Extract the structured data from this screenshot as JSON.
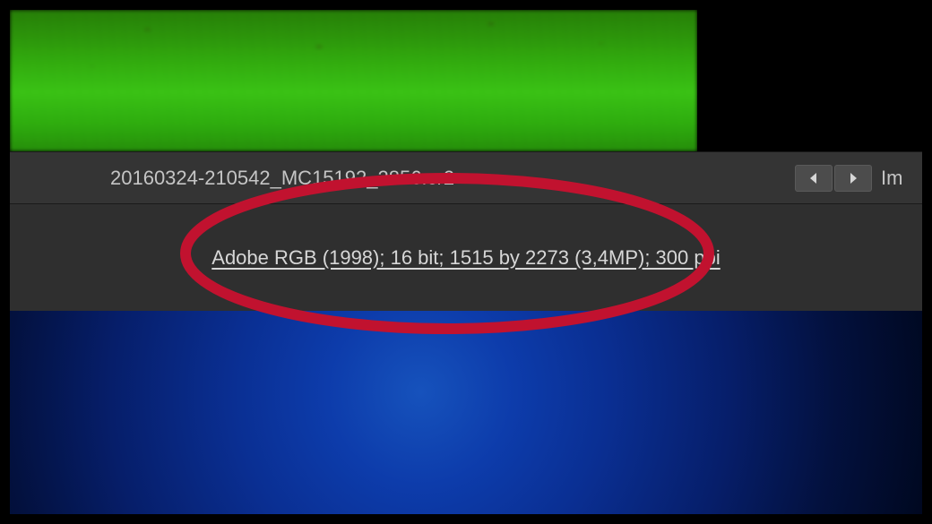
{
  "preview": {
    "description": "blurred green grass field"
  },
  "file_bar": {
    "filename": "20160324-210542_MC15192_2856.cr2",
    "nav_right_label": "Im"
  },
  "info_bar": {
    "workflow_link": "Adobe RGB (1998); 16 bit; 1515 by 2273 (3,4MP); 300 ppi"
  },
  "annotation": {
    "stroke_color": "#c1122f"
  }
}
